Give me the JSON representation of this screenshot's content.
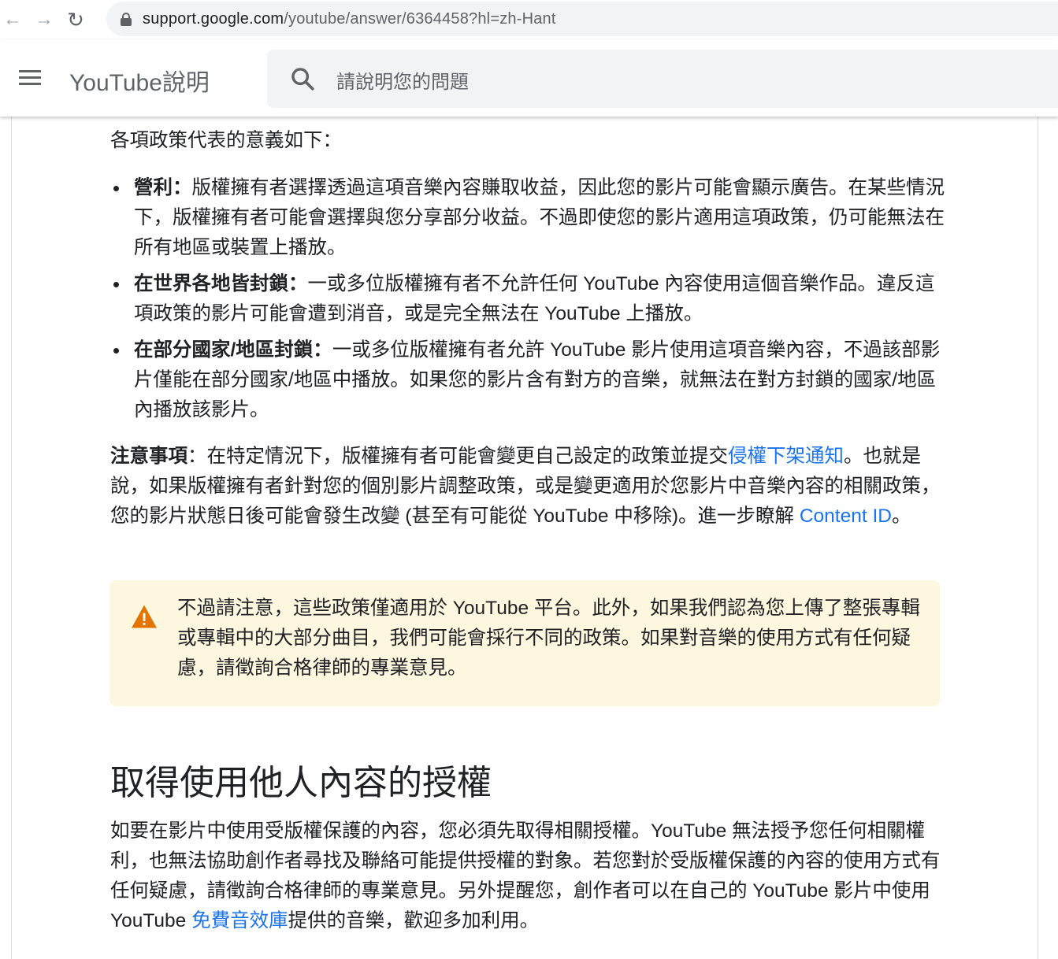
{
  "browser": {
    "url_host": "support.google.com",
    "url_path": "/youtube/answer/6364458?hl=zh-Hant"
  },
  "header": {
    "title": "YouTube說明",
    "search_placeholder": "請說明您的問題"
  },
  "content": {
    "intro": "各項政策代表的意義如下：",
    "policies": [
      {
        "term": "營利：",
        "text": "版權擁有者選擇透過這項音樂內容賺取收益，因此您的影片可能會顯示廣告。在某些情況下，版權擁有者可能會選擇與您分享部分收益。不過即使您的影片適用這項政策，仍可能無法在所有地區或裝置上播放。"
      },
      {
        "term": "在世界各地皆封鎖：",
        "text": "一或多位版權擁有者不允許任何 YouTube 內容使用這個音樂作品。違反這項政策的影片可能會遭到消音，或是完全無法在 YouTube 上播放。"
      },
      {
        "term": "在部分國家/地區封鎖：",
        "text": "一或多位版權擁有者允許 YouTube 影片使用這項音樂內容，不過該部影片僅能在部分國家/地區中播放。如果您的影片含有對方的音樂，就無法在對方封鎖的國家/地區內播放該影片。"
      }
    ],
    "note": {
      "term": "注意事項",
      "text_before": "：在特定情況下，版權擁有者可能會變更自己設定的政策並提交",
      "link1": "侵權下架通知",
      "text_middle": "。也就是說，如果版權擁有者針對您的個別影片調整政策，或是變更適用於您影片中音樂內容的相關政策，您的影片狀態日後可能會發生改變 (甚至有可能從 YouTube 中移除)。進一步瞭解 ",
      "link2": "Content ID",
      "text_after": "。"
    },
    "callout": "不過請注意，這些政策僅適用於 YouTube 平台。此外，如果我們認為您上傳了整張專輯或專輯中的大部分曲目，我們可能會採行不同的政策。如果對音樂的使用方式有任何疑慮，請徵詢合格律師的專業意見。",
    "section_title": "取得使用他人內容的授權",
    "section_body": {
      "text_before": "如要在影片中使用受版權保護的內容，您必須先取得相關授權。YouTube 無法授予您任何相關權利，也無法協助創作者尋找及聯絡可能提供授權的對象。若您對於受版權保護的內容的使用方式有任何疑慮，請徵詢合格律師的專業意見。另外提醒您，創作者可以在自己的 YouTube 影片中使用 YouTube ",
      "link": "免費音效庫",
      "text_after": "提供的音樂，歡迎多加利用。"
    }
  },
  "colors": {
    "link": "#1a73e8",
    "callout_bg": "#fef7e0",
    "warning": "#e37400"
  }
}
